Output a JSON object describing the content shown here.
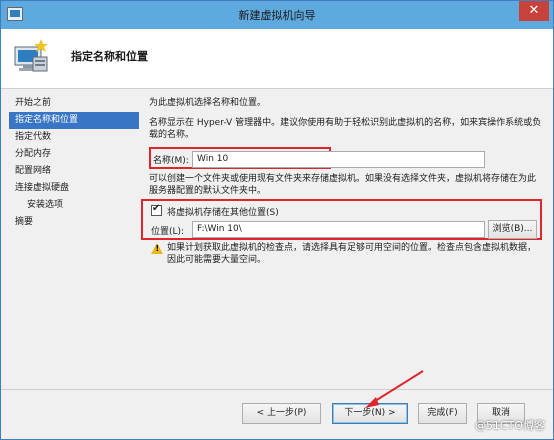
{
  "window": {
    "title": "新建虚拟机向导",
    "close_symbol": "✕"
  },
  "header": {
    "title": "指定名称和位置"
  },
  "nav": {
    "items": [
      {
        "label": "开始之前",
        "active": false,
        "sub": false
      },
      {
        "label": "指定名称和位置",
        "active": true,
        "sub": false
      },
      {
        "label": "指定代数",
        "active": false,
        "sub": false
      },
      {
        "label": "分配内存",
        "active": false,
        "sub": false
      },
      {
        "label": "配置网络",
        "active": false,
        "sub": false
      },
      {
        "label": "连接虚拟硬盘",
        "active": false,
        "sub": false
      },
      {
        "label": "安装选项",
        "active": false,
        "sub": true
      },
      {
        "label": "摘要",
        "active": false,
        "sub": false
      }
    ]
  },
  "content": {
    "intro": "为此虚拟机选择名称和位置。",
    "description": "名称显示在 Hyper-V 管理器中。建议你使用有助于轻松识别此虚拟机的名称，如来宾操作系统或负载的名称。",
    "name_label": "名称(M):",
    "name_value": "Win 10",
    "folder_hint": "可以创建一个文件夹或使用现有文件夹来存储虚拟机。如果没有选择文件夹，虚拟机将存储在为此服务器配置的默认文件夹中。",
    "store_checkbox_label": "将虚拟机存储在其他位置(S)",
    "store_checkbox_checked": true,
    "location_label": "位置(L):",
    "location_value": "F:\\Win 10\\",
    "browse_label": "浏览(B)...",
    "warning_text": "如果计划获取此虚拟机的检查点，请选择具有足够可用空间的位置。检查点包含虚拟机数据，因此可能需要大量空间。"
  },
  "footer": {
    "prev_label": "< 上一步(P)",
    "next_label": "下一步(N) >",
    "finish_label": "完成(F)",
    "cancel_label": "取消"
  },
  "watermark": "@51CTO博客",
  "colors": {
    "title_bar": "#5ea9dd",
    "nav_active": "#3875c4",
    "highlight_box": "#e0262c",
    "close_button": "#c7423a"
  }
}
